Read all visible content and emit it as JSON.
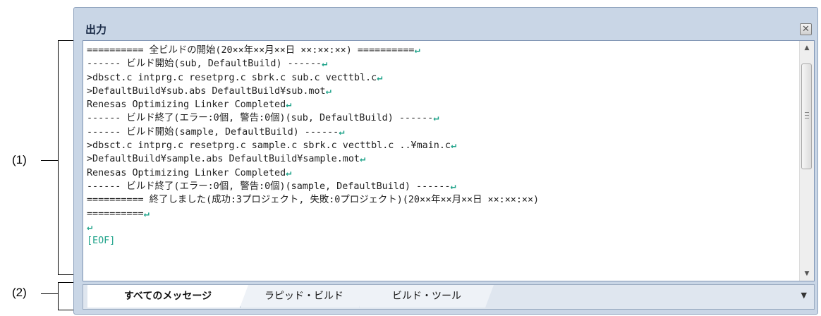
{
  "annotations": {
    "label_1": "(1)",
    "label_2": "(2)"
  },
  "panel": {
    "title": "出力",
    "close_icon": "close-icon"
  },
  "output": {
    "lines": [
      "========== 全ビルドの開始(20××年××月××日 ××:××:××) ==========",
      "------ ビルド開始(sub, DefaultBuild) ------",
      ">dbsct.c intprg.c resetprg.c sbrk.c sub.c vecttbl.c",
      ">DefaultBuild¥sub.abs DefaultBuild¥sub.mot",
      "Renesas Optimizing Linker Completed",
      "------ ビルド終了(エラー:0個, 警告:0個)(sub, DefaultBuild) ------",
      "------ ビルド開始(sample, DefaultBuild) ------",
      ">dbsct.c intprg.c resetprg.c sample.c sbrk.c vecttbl.c ..¥main.c",
      ">DefaultBuild¥sample.abs DefaultBuild¥sample.mot",
      "Renesas Optimizing Linker Completed",
      "------ ビルド終了(エラー:0個, 警告:0個)(sample, DefaultBuild) ------",
      "========== 終了しました(成功:3プロジェクト, 失敗:0プロジェクト)(20××年××月××日 ××:××:××)",
      "==========",
      ""
    ],
    "return_mark": "↵",
    "eof": "[EOF]"
  },
  "tabs": [
    {
      "label": "すべてのメッセージ",
      "active": true
    },
    {
      "label": "ラピッド・ビルド",
      "active": false
    },
    {
      "label": "ビルド・ツール",
      "active": false
    }
  ],
  "colors": {
    "panel_bg": "#c9d6e6",
    "return_mark": "#1fa38a"
  }
}
